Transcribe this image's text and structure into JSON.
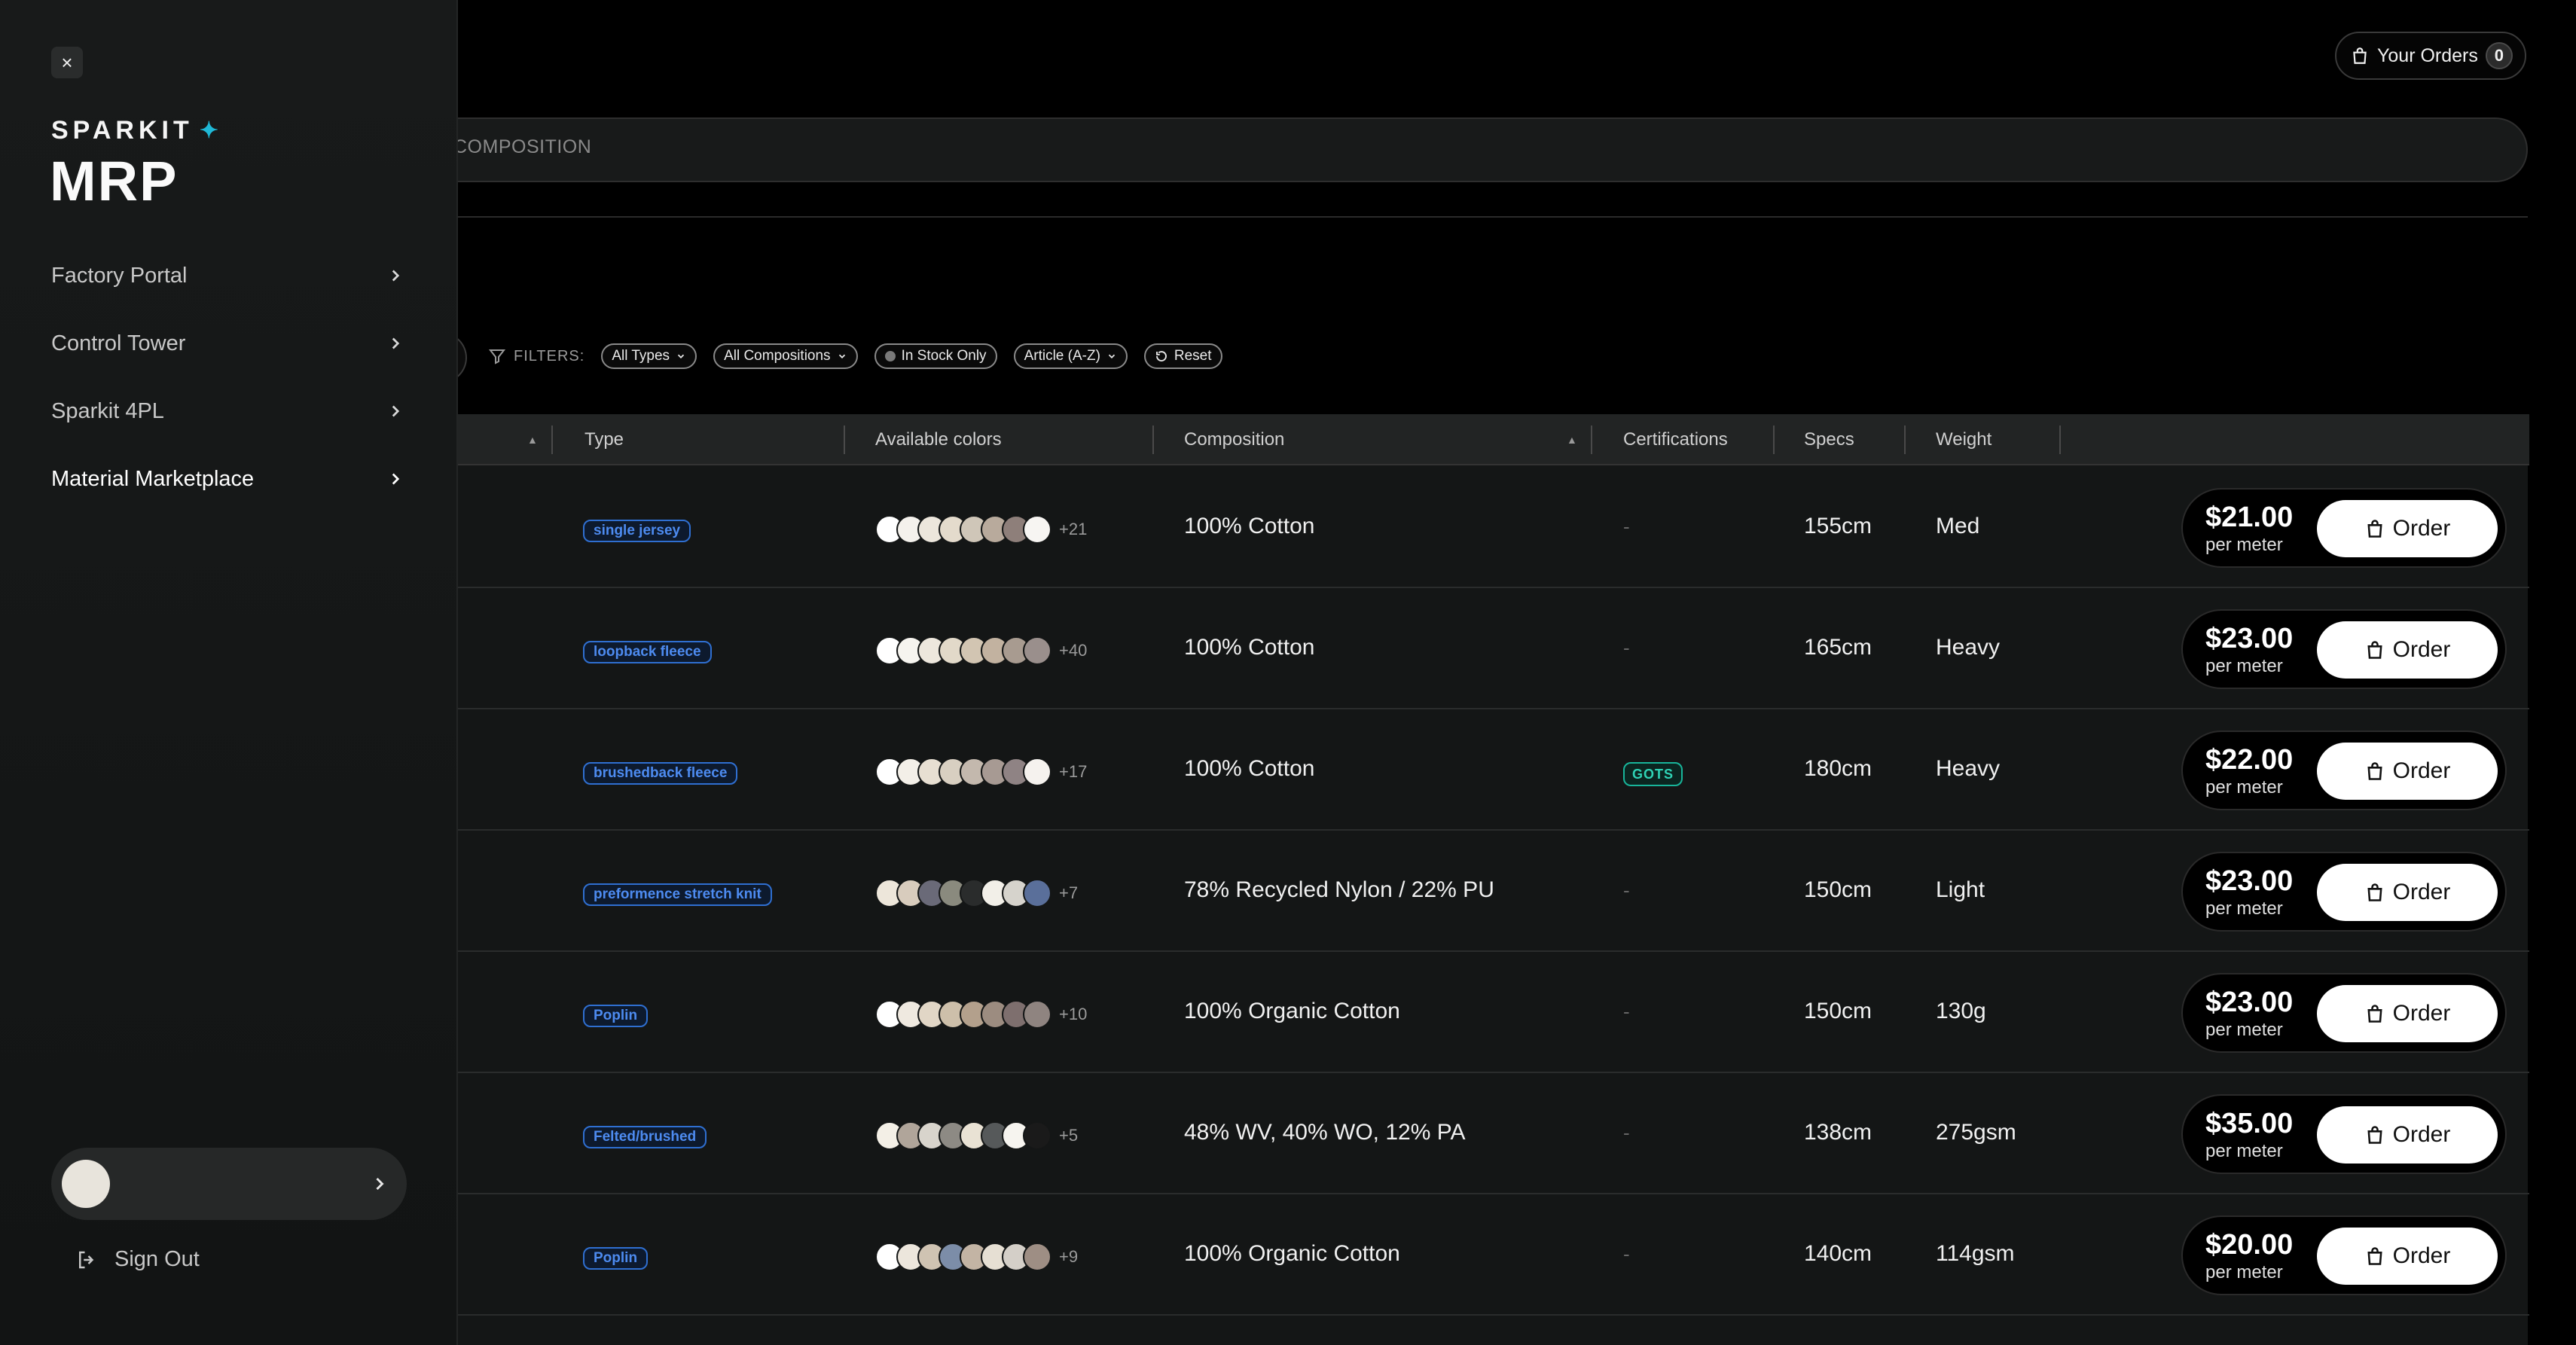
{
  "header": {
    "orders_label": "Your Orders",
    "orders_count": "0",
    "search_text": "COMPOSITION"
  },
  "filters": {
    "label": "FILTERS:",
    "type": "All Types",
    "composition": "All Compositions",
    "stock": "In Stock Only",
    "sort": "Article (A-Z)",
    "reset": "Reset"
  },
  "table": {
    "columns": {
      "type": "Type",
      "colors": "Available colors",
      "composition": "Composition",
      "certifications": "Certifications",
      "specs": "Specs",
      "weight": "Weight"
    },
    "per_unit": "per meter",
    "order_label": "Order",
    "rows": [
      {
        "type": "single jersey",
        "swatches": [
          "#ffffff",
          "#f4f1ec",
          "#ece6dc",
          "#e4dbcc",
          "#cfc6b8",
          "#b8aa9c",
          "#8e7f7a",
          "#f7f5f2"
        ],
        "more": "+21",
        "composition": "100% Cotton",
        "cert": "-",
        "specs": "155cm",
        "weight": "Med",
        "price": "$21.00"
      },
      {
        "type": "loopback fleece",
        "swatches": [
          "#ffffff",
          "#f6f4ef",
          "#ede7dd",
          "#e2d9c9",
          "#d2c5b2",
          "#c2b2a0",
          "#a89b90",
          "#9a8f8c"
        ],
        "more": "+40",
        "composition": "100% Cotton",
        "cert": "-",
        "specs": "165cm",
        "weight": "Heavy",
        "price": "$23.00"
      },
      {
        "type": "brushedback fleece",
        "swatches": [
          "#ffffff",
          "#f3efe8",
          "#e7dfd2",
          "#d8cfc1",
          "#c3b8ad",
          "#a79a93",
          "#8f8384",
          "#f5f2ee"
        ],
        "more": "+17",
        "composition": "100% Cotton",
        "cert": "GOTS",
        "specs": "180cm",
        "weight": "Heavy",
        "price": "$22.00"
      },
      {
        "type": "preformence stretch knit",
        "swatches": [
          "#ede6da",
          "#d8ccbd",
          "#6a6a78",
          "#8a8a7e",
          "#2a2c2c",
          "#f2efe8",
          "#d6d3cc",
          "#5a6f9a"
        ],
        "more": "+7",
        "composition": "78% Recycled Nylon / 22% PU",
        "cert": "-",
        "specs": "150cm",
        "weight": "Light",
        "price": "$23.00"
      },
      {
        "type": "Poplin",
        "swatches": [
          "#ffffff",
          "#efe9e0",
          "#e1d6c6",
          "#cdbfaa",
          "#b3a08c",
          "#9c8c80",
          "#7e6f6e",
          "#8f8480"
        ],
        "more": "+10",
        "composition": "100% Organic Cotton",
        "cert": "-",
        "specs": "150cm",
        "weight": "130g",
        "price": "$23.00"
      },
      {
        "type": "Felted/brushed",
        "swatches": [
          "#f3efe6",
          "#b0a59a",
          "#d8d4cc",
          "#8d8a84",
          "#e9e2d4",
          "#56595a",
          "#f6f4ef",
          "#1a1a1a"
        ],
        "more": "+5",
        "composition": "48% WV, 40% WO, 12% PA",
        "cert": "-",
        "specs": "138cm",
        "weight": "275gsm",
        "price": "$35.00"
      },
      {
        "type": "Poplin",
        "swatches": [
          "#ffffff",
          "#ece6dc",
          "#cfc3b2",
          "#7c8da8",
          "#c3b4a4",
          "#e6dfd3",
          "#d4cfc8",
          "#9e8e84"
        ],
        "more": "+9",
        "composition": "100% Organic Cotton",
        "cert": "-",
        "specs": "140cm",
        "weight": "114gsm",
        "price": "$20.00"
      }
    ]
  },
  "sidebar": {
    "brand_top": "SPARKIT",
    "brand_main": "MRP",
    "items": [
      {
        "label": "Factory Portal"
      },
      {
        "label": "Control Tower"
      },
      {
        "label": "Sparkit 4PL"
      },
      {
        "label": "Material Marketplace"
      }
    ],
    "signout": "Sign Out"
  },
  "colors": {
    "accent_star": "#1fb8d6",
    "type_tag": "#4d8bf0",
    "gots": "#2fd3b5"
  }
}
